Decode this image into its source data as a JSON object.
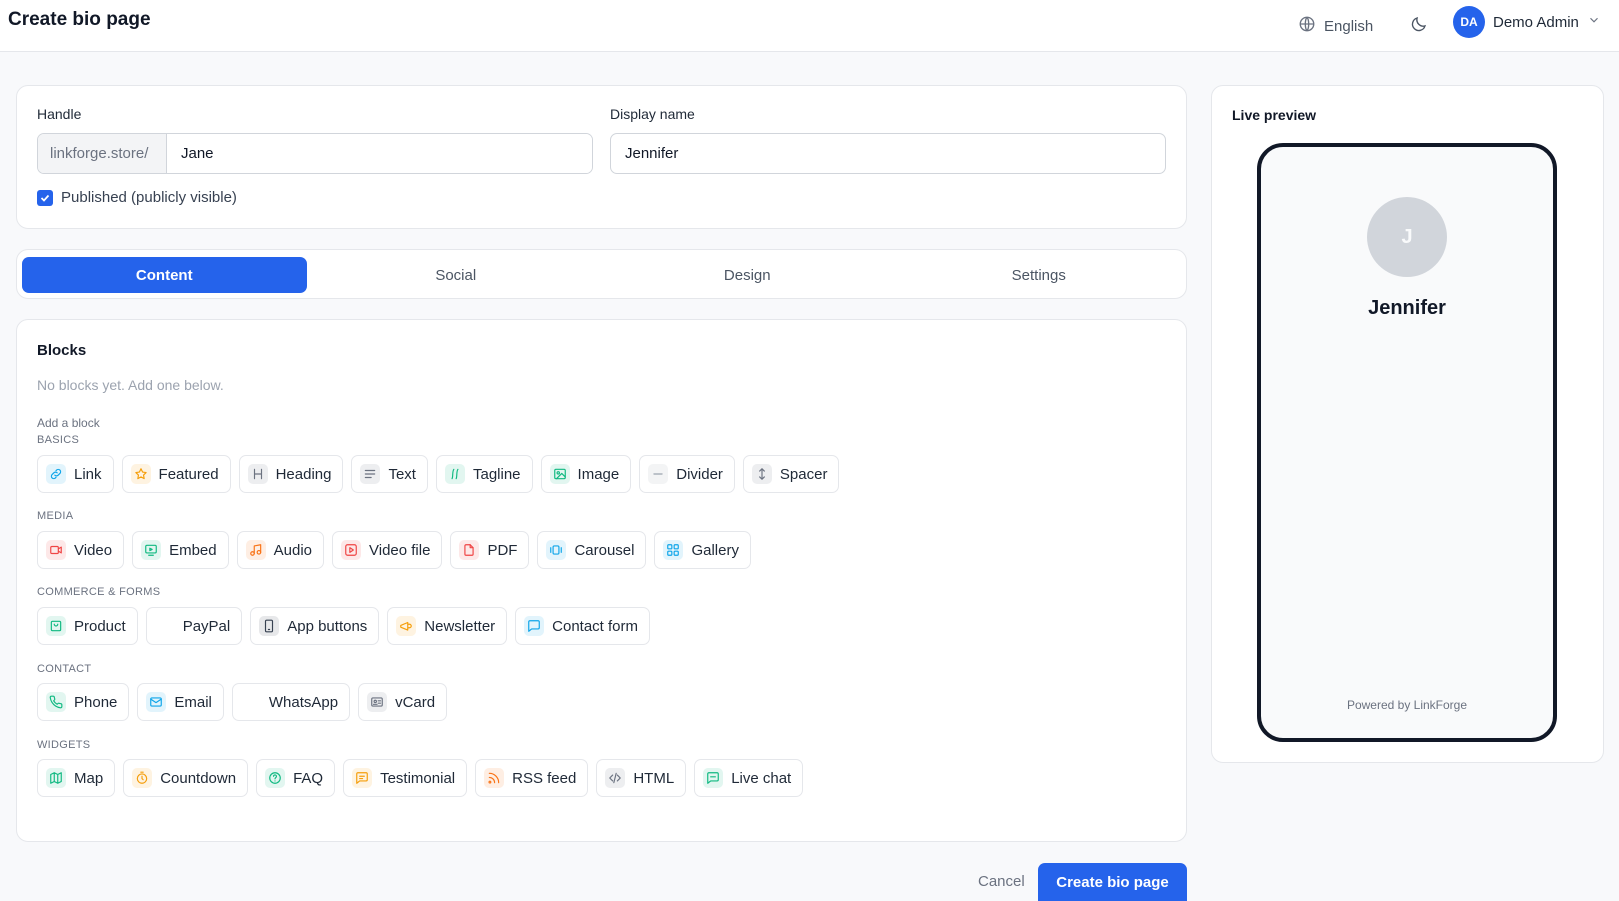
{
  "header": {
    "title": "Create bio page",
    "language": "English",
    "user": {
      "initials": "DA",
      "name": "Demo Admin"
    }
  },
  "identity": {
    "handle_label": "Handle",
    "handle_prefix": "linkforge.store/",
    "handle_value": "Jane",
    "display_label": "Display name",
    "display_value": "Jennifer",
    "published_label": "Published (publicly visible)",
    "published": true
  },
  "tabs": [
    {
      "label": "Content",
      "active": true
    },
    {
      "label": "Social",
      "active": false
    },
    {
      "label": "Design",
      "active": false
    },
    {
      "label": "Settings",
      "active": false
    }
  ],
  "blocks": {
    "title": "Blocks",
    "empty": "No blocks yet. Add one below.",
    "add_label": "Add a block",
    "groups": [
      {
        "label": "BASICS",
        "items": [
          {
            "label": "Link",
            "icon": "link-icon",
            "color": "#0ea5e9"
          },
          {
            "label": "Featured",
            "icon": "star-icon",
            "color": "#f59e0b"
          },
          {
            "label": "Heading",
            "icon": "heading-icon",
            "color": "#6b7280"
          },
          {
            "label": "Text",
            "icon": "text-lines-icon",
            "color": "#6b7280"
          },
          {
            "label": "Tagline",
            "icon": "tagline-icon",
            "color": "#10b981"
          },
          {
            "label": "Image",
            "icon": "image-icon",
            "color": "#10b981"
          },
          {
            "label": "Divider",
            "icon": "divider-icon",
            "color": "#9ca3af"
          },
          {
            "label": "Spacer",
            "icon": "spacer-icon",
            "color": "#6b7280"
          }
        ]
      },
      {
        "label": "MEDIA",
        "items": [
          {
            "label": "Video",
            "icon": "video-icon",
            "color": "#ef4444"
          },
          {
            "label": "Embed",
            "icon": "embed-icon",
            "color": "#10b981"
          },
          {
            "label": "Audio",
            "icon": "music-icon",
            "color": "#f97316"
          },
          {
            "label": "Video file",
            "icon": "video-file-icon",
            "color": "#ef4444"
          },
          {
            "label": "PDF",
            "icon": "pdf-icon",
            "color": "#ef4444"
          },
          {
            "label": "Carousel",
            "icon": "carousel-icon",
            "color": "#0ea5e9"
          },
          {
            "label": "Gallery",
            "icon": "gallery-icon",
            "color": "#0ea5e9"
          }
        ]
      },
      {
        "label": "COMMERCE & FORMS",
        "items": [
          {
            "label": "Product",
            "icon": "product-icon",
            "color": "#10b981"
          },
          {
            "label": "PayPal",
            "icon": "paypal-icon",
            "color": ""
          },
          {
            "label": "App buttons",
            "icon": "phone-device-icon",
            "color": "#374151"
          },
          {
            "label": "Newsletter",
            "icon": "megaphone-icon",
            "color": "#f59e0b"
          },
          {
            "label": "Contact form",
            "icon": "message-icon",
            "color": "#0ea5e9"
          }
        ]
      },
      {
        "label": "CONTACT",
        "items": [
          {
            "label": "Phone",
            "icon": "phone-icon",
            "color": "#10b981"
          },
          {
            "label": "Email",
            "icon": "mail-icon",
            "color": "#0ea5e9"
          },
          {
            "label": "WhatsApp",
            "icon": "whatsapp-icon",
            "color": ""
          },
          {
            "label": "vCard",
            "icon": "vcard-icon",
            "color": "#6b7280"
          }
        ]
      },
      {
        "label": "WIDGETS",
        "items": [
          {
            "label": "Map",
            "icon": "map-icon",
            "color": "#10b981"
          },
          {
            "label": "Countdown",
            "icon": "timer-icon",
            "color": "#f59e0b"
          },
          {
            "label": "FAQ",
            "icon": "help-circle-icon",
            "color": "#10b981"
          },
          {
            "label": "Testimonial",
            "icon": "quote-icon",
            "color": "#f59e0b"
          },
          {
            "label": "RSS feed",
            "icon": "rss-icon",
            "color": "#f97316"
          },
          {
            "label": "HTML",
            "icon": "code-icon",
            "color": "#6b7280"
          },
          {
            "label": "Live chat",
            "icon": "chat-icon",
            "color": "#10b981"
          }
        ]
      }
    ]
  },
  "preview": {
    "title": "Live preview",
    "avatar_initial": "J",
    "name": "Jennifer",
    "footer": "Powered by LinkForge"
  },
  "actions": {
    "cancel": "Cancel",
    "submit": "Create bio page"
  },
  "colors": {
    "accent": "#2563eb",
    "border": "#e5e7eb",
    "muted": "#6b7280"
  }
}
